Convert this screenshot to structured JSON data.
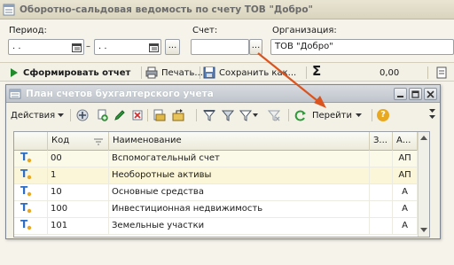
{
  "main_window": {
    "title": "Оборотно-сальдовая ведомость по счету  ТОВ \"Добро\"",
    "period_label": "Период:",
    "period_from": ". .",
    "period_to": ". .",
    "period_dash": "–",
    "period_more": "...",
    "account_label": "Счет:",
    "account_value": "",
    "account_select": "...",
    "org_label": "Организация:",
    "org_value": "ТОВ \"Добро\""
  },
  "main_toolbar": {
    "generate": "Сформировать отчет",
    "print": "Печать...",
    "save": "Сохранить как...",
    "sum_sign": "Σ",
    "sum_value": "0,00"
  },
  "popup": {
    "title": "План счетов бухгалтерского учета",
    "actions": "Действия",
    "goto": "Перейти",
    "help": "?"
  },
  "grid": {
    "columns": [
      "Код",
      "Наименование",
      "З...",
      "А..."
    ],
    "rows": [
      {
        "code": "00",
        "name": "Вспомогательный счет",
        "z": "",
        "a": "АП"
      },
      {
        "code": "1",
        "name": "Необоротные активы",
        "z": "",
        "a": "АП"
      },
      {
        "code": "10",
        "name": "Основные средства",
        "z": "",
        "a": "А"
      },
      {
        "code": "100",
        "name": "Инвестиционная недвижимость",
        "z": "",
        "a": "А"
      },
      {
        "code": "101",
        "name": "Земельные участки",
        "z": "",
        "a": "А"
      }
    ]
  },
  "colors": {
    "accent_red_arrow": "#d9541e",
    "row_highlight": "#fbf9e8",
    "account_icon": "#2e6dc4"
  }
}
